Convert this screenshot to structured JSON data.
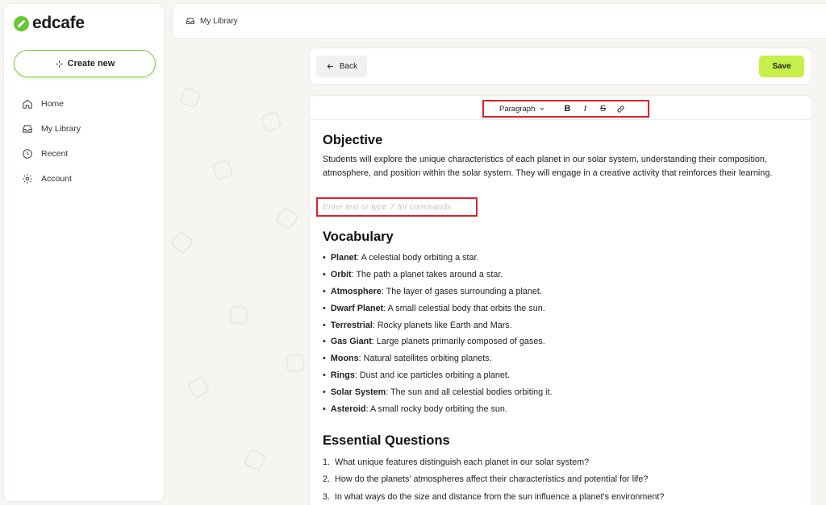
{
  "app": {
    "logo_text": "edcafe",
    "brand_color": "#6cc33a",
    "accent_color": "#c6ef4c",
    "highlight_color": "#e0202a"
  },
  "sidebar": {
    "create_label": "Create new",
    "items": [
      {
        "label": "Home",
        "icon": "home-icon"
      },
      {
        "label": "My Library",
        "icon": "library-icon"
      },
      {
        "label": "Recent",
        "icon": "clock-icon"
      },
      {
        "label": "Account",
        "icon": "gear-icon"
      }
    ]
  },
  "header": {
    "breadcrumb": "My Library"
  },
  "actions": {
    "back_label": "Back",
    "save_label": "Save"
  },
  "toolbar": {
    "block_type": "Paragraph",
    "bold": "B",
    "italic": "I",
    "strike": "S"
  },
  "doc": {
    "objective_title": "Objective",
    "objective_text": "Students will explore the unique characteristics of each planet in our solar system, understanding their composition, atmosphere, and position within the solar system. They will engage in a creative activity that reinforces their learning.",
    "placeholder": "Enter text or type '/' for commands",
    "vocab_title": "Vocabulary",
    "vocab": [
      {
        "term": "Planet",
        "def": ": A celestial body orbiting a star."
      },
      {
        "term": "Orbit",
        "def": ": The path a planet takes around a star."
      },
      {
        "term": "Atmosphere",
        "def": ": The layer of gases surrounding a planet."
      },
      {
        "term": "Dwarf Planet",
        "def": ": A small celestial body that orbits the sun."
      },
      {
        "term": "Terrestrial",
        "def": ": Rocky planets like Earth and Mars."
      },
      {
        "term": "Gas Giant",
        "def": ": Large planets primarily composed of gases."
      },
      {
        "term": "Moons",
        "def": ": Natural satellites orbiting planets."
      },
      {
        "term": "Rings",
        "def": ": Dust and ice particles orbiting a planet."
      },
      {
        "term": "Solar System",
        "def": ": The sun and all celestial bodies orbiting it."
      },
      {
        "term": "Asteroid",
        "def": ": A small rocky body orbiting the sun."
      }
    ],
    "eq_title": "Essential Questions",
    "questions": [
      {
        "num": "1.",
        "text": "What unique features distinguish each planet in our solar system?"
      },
      {
        "num": "2.",
        "text": "How do the planets' atmospheres affect their characteristics and potential for life?"
      },
      {
        "num": "3.",
        "text": "In what ways do the size and distance from the sun influence a planet's environment?"
      }
    ]
  }
}
